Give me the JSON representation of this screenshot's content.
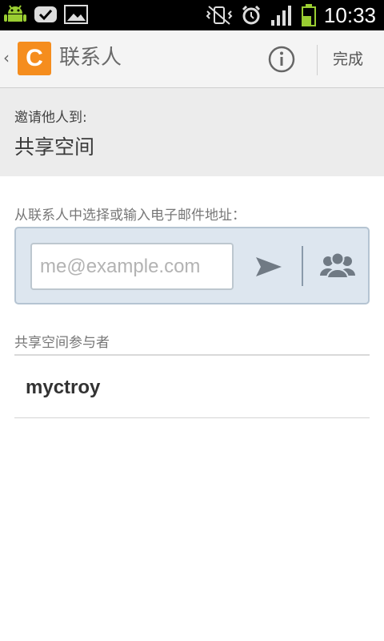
{
  "status_bar": {
    "time": "10:33",
    "left_icons": [
      "android-icon",
      "checkmark-icon",
      "image-icon"
    ],
    "right_icons": [
      "vibrate-icon",
      "alarm-icon",
      "signal-icon",
      "battery-icon"
    ]
  },
  "action_bar": {
    "logo_letter": "C",
    "title": "联系人",
    "done_label": "完成"
  },
  "invite": {
    "label": "邀请他人到:",
    "target": "共享空间"
  },
  "input_section": {
    "hint": "从联系人中选择或输入电子邮件地址：",
    "email_placeholder": "me@example.com",
    "email_value": ""
  },
  "participants": {
    "header": "共享空间参与者",
    "items": [
      {
        "name": "myctroy"
      }
    ]
  },
  "colors": {
    "accent_orange": "#f58d1e",
    "battery_green": "#9acd32",
    "panel_bg": "#dde6ef"
  }
}
